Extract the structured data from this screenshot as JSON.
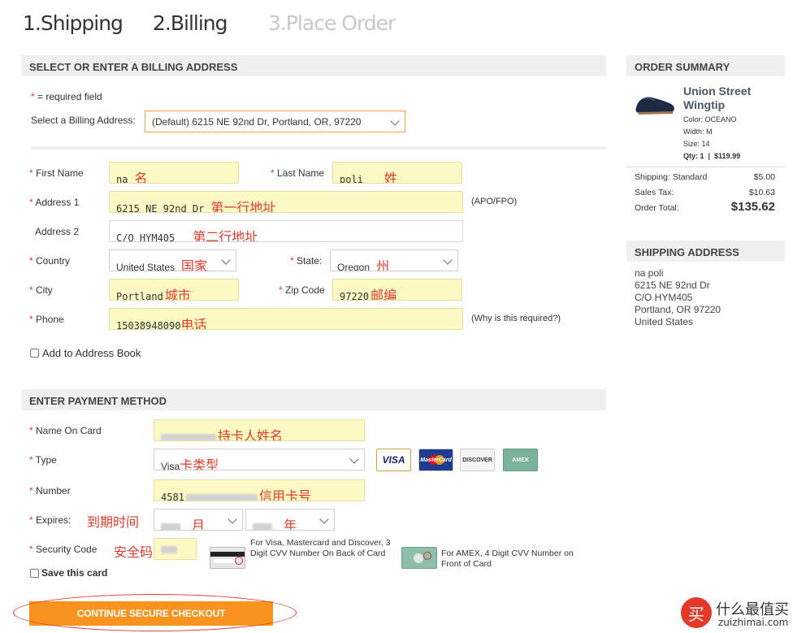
{
  "steps": {
    "shipping": "1.Shipping",
    "billing": "2.Billing",
    "place_order": "3.Place Order"
  },
  "billing": {
    "section_title": "SELECT OR ENTER A BILLING ADDRESS",
    "required_note": "= required field",
    "select_label": "Select a Billing Address:",
    "select_value": "(Default) 6215 NE 92nd Dr, Portland, OR, 97220",
    "first_name_label": "First Name",
    "first_name_value": "na",
    "first_name_ann": "名",
    "last_name_label": "Last Name",
    "last_name_value": "poli",
    "last_name_ann": "姓",
    "address1_label": "Address 1",
    "address1_value": "6215 NE 92nd Dr",
    "address1_ann": "第一行地址",
    "apo": "(APO/FPO)",
    "address2_label": "Address 2",
    "address2_value": "C/O HYM405",
    "address2_ann": "第二行地址",
    "country_label": "Country",
    "country_value": "United States",
    "country_ann": "国家",
    "state_label": "State:",
    "state_value": "Oregon",
    "state_ann": "州",
    "city_label": "City",
    "city_value": "Portland",
    "city_ann": "城市",
    "zip_label": "Zip Code",
    "zip_value": "97220",
    "zip_ann": "邮编",
    "phone_label": "Phone",
    "phone_value": "15038948090",
    "phone_ann": "电话",
    "why": "(Why is this required?)",
    "add_book": "Add to Address Book"
  },
  "payment": {
    "section_title": "ENTER PAYMENT METHOD",
    "name_label": "Name On Card",
    "name_ann": "持卡人姓名",
    "type_label": "Type",
    "type_value": "Visa",
    "type_ann": "卡类型",
    "cards": {
      "visa": "VISA",
      "mastercard": "MasterCard",
      "discover": "DISCOVER",
      "amex": "AMEX"
    },
    "number_label": "Number",
    "number_value": "4581",
    "number_ann": "信用卡号",
    "expires_label": "Expires:",
    "expires_ann": "到期时间",
    "month_ann": "月",
    "year_ann": "年",
    "cvv_label": "Security Code",
    "cvv_ann": "安全码",
    "cvv_note1": "For Visa, Mastercard and Discover, 3 Digit CVV Number On Back of Card",
    "cvv_note2": "For AMEX, 4 Digit CVV Number on Front of Card",
    "save_card": "Save this card",
    "continue": "CONTINUE SECURE CHECKOUT"
  },
  "summary": {
    "title": "ORDER SUMMARY",
    "product_name": "Union Street Wingtip",
    "color": "Color: OCEANO",
    "width": "Width: M",
    "size": "Size: 14",
    "qty": "Qty: 1",
    "price": "$119.99",
    "shipping_label": "Shipping: Standard",
    "shipping_value": "$5.00",
    "tax_label": "Sales Tax:",
    "tax_value": "$10.63",
    "total_label": "Order Total:",
    "total_value": "$135.62"
  },
  "shipping_address": {
    "title": "SHIPPING ADDRESS",
    "lines": [
      "na poli",
      "6215 NE 92nd Dr",
      "C/O HYM405",
      "Portland, OR 97220",
      "United States"
    ]
  },
  "watermark": {
    "icon": "买",
    "name": "什么最值买",
    "url": "zuizhimai.com"
  },
  "colors": {
    "accent": "#f7931e",
    "required": "#e03c31",
    "annotation": "#e23a2a",
    "highlight": "#fdf9c4"
  }
}
